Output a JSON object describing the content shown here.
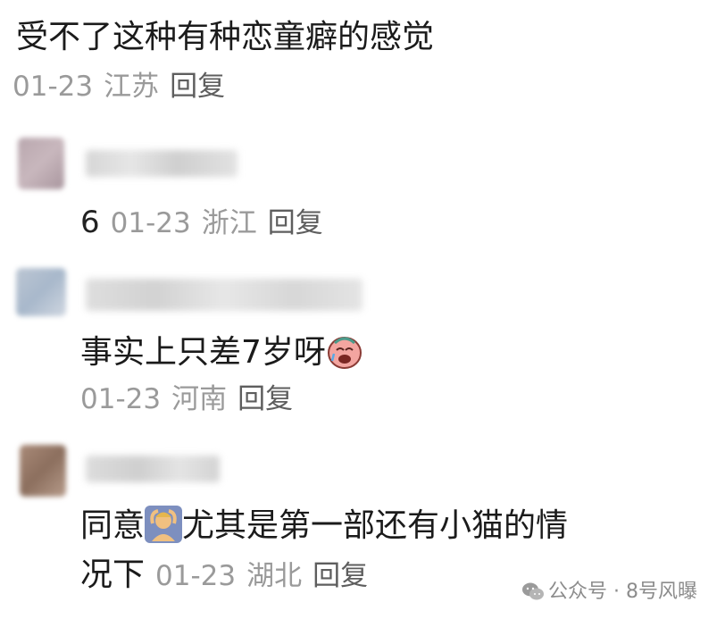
{
  "comments": [
    {
      "text": "受不了这种有种恋童癖的感觉",
      "date": "01-23",
      "location": "江苏",
      "reply_label": "回复"
    },
    {
      "likes": "6",
      "date": "01-23",
      "location": "浙江",
      "reply_label": "回复"
    },
    {
      "text": "事实上只差7岁呀",
      "emoji": "crying-face-emoji",
      "date": "01-23",
      "location": "河南",
      "reply_label": "回复"
    },
    {
      "text_part1": "同意",
      "emoji": "person-gesturing-ok-emoji",
      "text_part2": "尤其是第一部还有小猫的情",
      "text_line2": "况下",
      "date": "01-23",
      "location": "湖北",
      "reply_label": "回复"
    }
  ],
  "watermark": "公众号 · 8号风曝",
  "icons": {
    "watermark_icon": "wechat-icon"
  },
  "colors": {
    "text": "#1b1b1b",
    "meta": "#9a9a9a",
    "reply": "#5e5e5e"
  }
}
